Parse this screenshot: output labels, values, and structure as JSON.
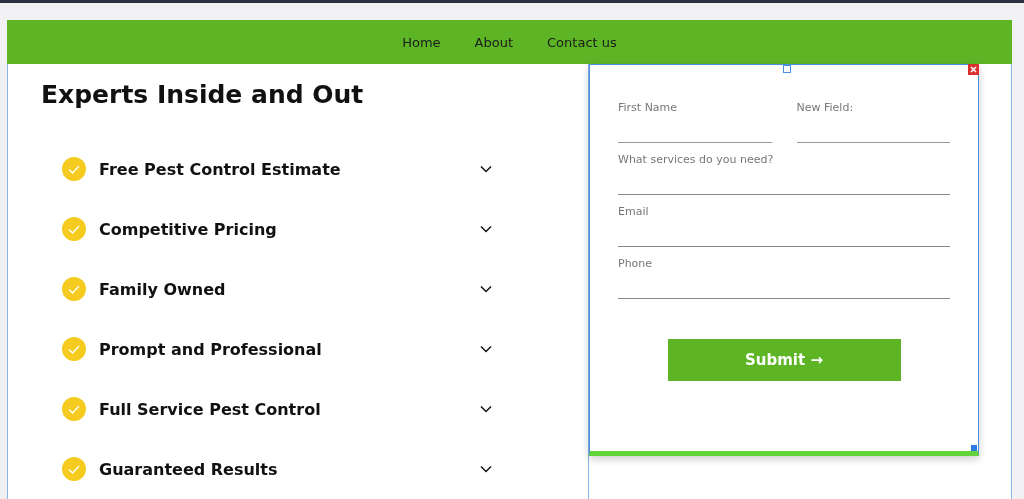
{
  "nav": {
    "links": [
      {
        "label": "Home"
      },
      {
        "label": "About"
      },
      {
        "label": "Contact us"
      }
    ]
  },
  "heading": "Experts Inside and Out",
  "features": [
    {
      "label": "Free Pest Control Estimate"
    },
    {
      "label": "Competitive Pricing"
    },
    {
      "label": "Family Owned"
    },
    {
      "label": "Prompt and Professional"
    },
    {
      "label": "Full Service Pest Control"
    },
    {
      "label": "Guaranteed Results"
    }
  ],
  "form": {
    "rows": [
      [
        {
          "label": "First Name"
        },
        {
          "label": "New Field:"
        }
      ],
      [
        {
          "label": "What services do you need?"
        }
      ],
      [
        {
          "label": "Email"
        }
      ],
      [
        {
          "label": "Phone"
        }
      ]
    ],
    "submit": "Submit →"
  }
}
